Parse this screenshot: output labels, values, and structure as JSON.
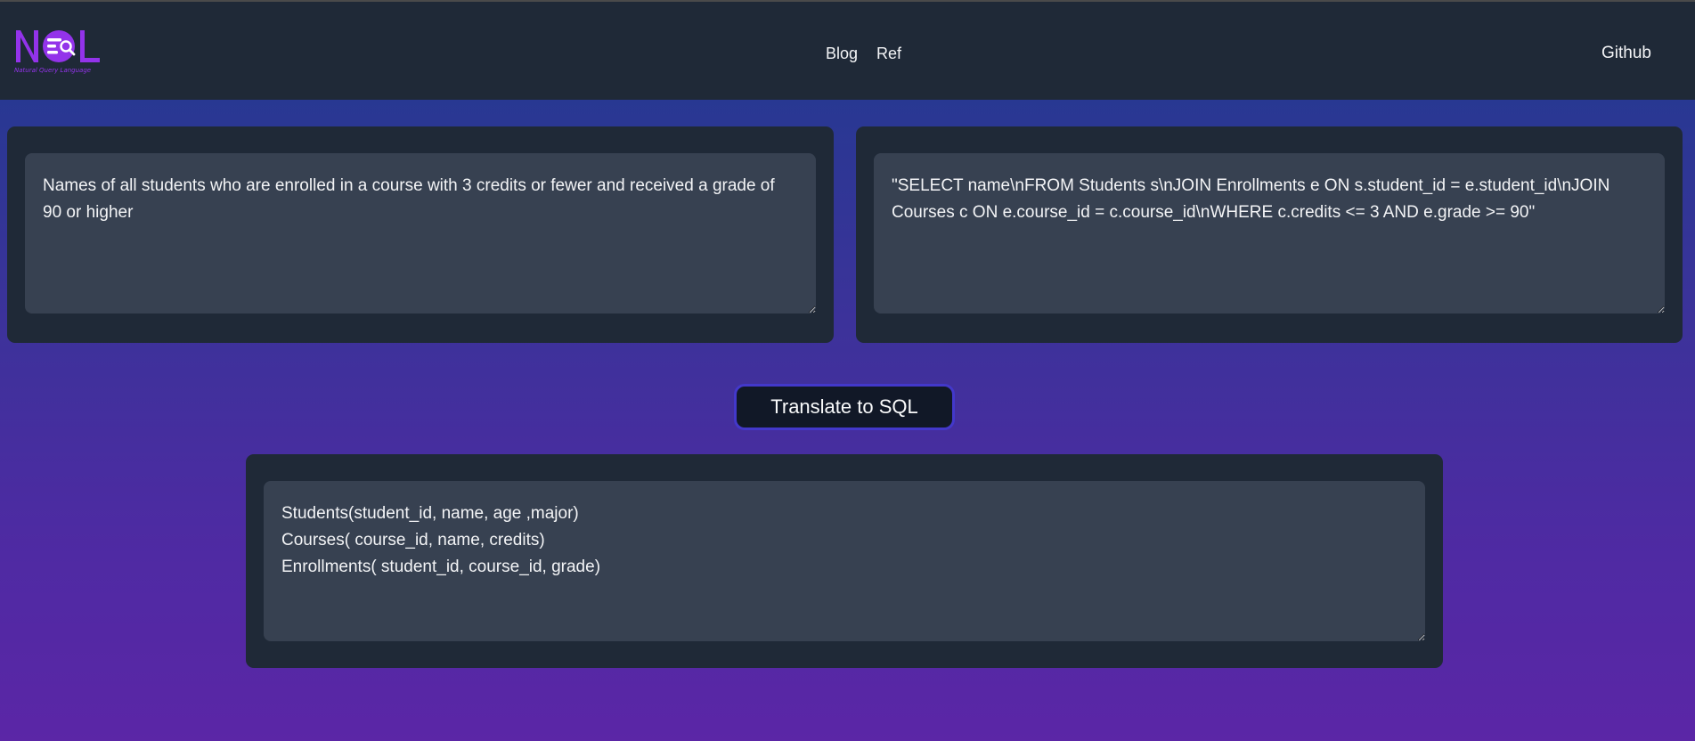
{
  "header": {
    "logo_text": "NQL",
    "logo_tagline": "Natural Query Language",
    "nav": [
      {
        "label": "Blog"
      },
      {
        "label": "Ref"
      }
    ],
    "github_label": "Github"
  },
  "colors": {
    "navbar_bg": "#1f2937",
    "panel_bg": "#1f2937",
    "field_bg": "#374151",
    "button_bg": "#111827",
    "button_border": "#4338ca",
    "logo_purple": "#9333ea",
    "gradient_top": "#1f3a8f",
    "gradient_bottom": "#5b26a6"
  },
  "question_input": {
    "value": "Names of all students who are enrolled in a course with 3 credits or fewer and received a grade of 90 or higher"
  },
  "sql_output": {
    "value": "\"SELECT name\\nFROM Students s\\nJOIN Enrollments e ON s.student_id = e.student_id\\nJOIN Courses c ON e.course_id = c.course_id\\nWHERE c.credits <= 3 AND e.grade >= 90\""
  },
  "translate_button": {
    "label": "Translate to SQL"
  },
  "schema_input": {
    "value": "Students(student_id, name, age ,major)\nCourses( course_id, name, credits)\nEnrollments( student_id, course_id, grade)"
  }
}
